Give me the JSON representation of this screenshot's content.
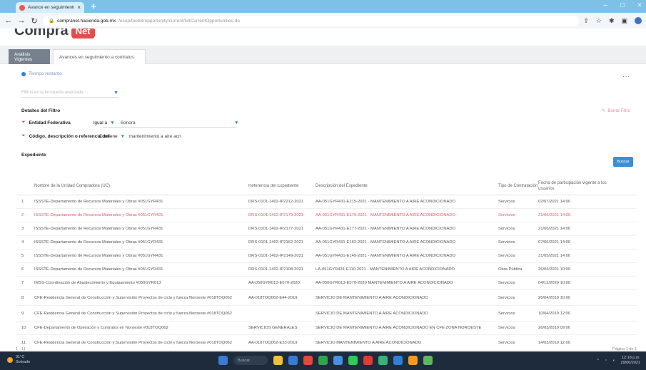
{
  "browser": {
    "tab_title": "Avance en seguimiento a con",
    "tab_close": "×",
    "new_tab": "+",
    "url_host": "compranet.hacienda.gob.mx",
    "url_path": "/esop/toolkit/opportunity/current/listCurrentOpportunities.do",
    "controls": {
      "minimize": "–",
      "maximize": "□",
      "close": "×"
    }
  },
  "site": {
    "brand": "Compra",
    "badge": "Net"
  },
  "tabs": [
    {
      "label": "Análisis Vigentes"
    },
    {
      "label": "Avances en seguimiento a contratos"
    }
  ],
  "info_link": "Tiempo restante",
  "more": "...",
  "filter_select_placeholder": "Filtros en la búsqueda avanzada",
  "details_title": "Detalles del Filtro",
  "clear_filters": "Borrar Filtro",
  "filters": [
    {
      "name": "Entidad Federativa",
      "operator": "Igual a",
      "value": "Sonora"
    },
    {
      "name": "Código, descripción o referencia del",
      "operator": "Contiene",
      "value": "mantenimiento a aire acn"
    }
  ],
  "expediente_label": "Expediente",
  "search_button": "Buscar",
  "table": {
    "headers": [
      "",
      "Nombre de la Unidad Compradora (UC)",
      "Referencia del Expediente",
      "Descripción del Expediente",
      "Tipo de Contratación",
      "Fecha de participación vigente a los usuarios"
    ],
    "rows": [
      {
        "n": "1",
        "uc": "ISSSTE-Departamento de Recursos Materiales y Obras #051GYR431",
        "ref": "DRS-0101-1402-IP2212-2021",
        "desc": "AA-051GYR431-E215-2021 - MANTENIMIENTO A AIRE ACONDICIONADO",
        "tipo": "Servicios",
        "fecha": "02/07/2021 14:00"
      },
      {
        "n": "2",
        "uc": "ISSSTE-Departamento de Recursos Materiales y Obras #051GYR431",
        "ref": "DRS-0101-1402-IP2179-2021",
        "desc": "AA-051GYR431-E179-2021 - MANTENIMIENTO A AIRE ACONDICIONADO",
        "tipo": "Servicios",
        "fecha": "21/06/2021 14:00"
      },
      {
        "n": "3",
        "uc": "ISSSTE-Departamento de Recursos Materiales y Obras #051GYR431",
        "ref": "DRS-0101-1402-IP2177-2021",
        "desc": "AA-051GYR431-E177-2021 - MANTENIMIENTO A AIRE ACONDICIONADO",
        "tipo": "Servicios",
        "fecha": "21/06/2021 14:00"
      },
      {
        "n": "4",
        "uc": "ISSSTE-Departamento de Recursos Materiales y Obras #051GYR431",
        "ref": "DRS-0101-1402-IP2162-2021",
        "desc": "AA-051GYR431-E162-2021 - MANTENIMIENTO A AIRE ACONDICIONADO",
        "tipo": "Servicios",
        "fecha": "07/06/2021 14:00"
      },
      {
        "n": "5",
        "uc": "ISSSTE-Departamento de Recursos Materiales y Obras #051GYR431",
        "ref": "DRS-0101-1402-IP2149-2021",
        "desc": "AA-051GYR431-E149-2021 - MANTENIMIENTO A AIRE ACONDICIONADO",
        "tipo": "Servicios",
        "fecha": "31/05/2021 14:00"
      },
      {
        "n": "6",
        "uc": "ISSSTE-Departamento de Recursos Materiales y Obras #051GYR431",
        "ref": "DRS-0101-1402-IP2108-2021",
        "desc": "LA-051GYR431-E110-2021 - MANTENIMIENTO A AIRE ACONDICIONADO",
        "tipo": "Obra Pública",
        "fecha": "26/04/2021 10:00"
      },
      {
        "n": "7",
        "uc": "IMSS-Coordinación de Abastecimiento y Equipamiento #050GYR013",
        "ref": "AA-050GYR013-E570-2020",
        "desc": "AA-050GYR013-E570-2020 MANTENIMIENTO A AIRE ACONDICIONADO",
        "tipo": "Servicios",
        "fecha": "04/12/2020 10:00"
      },
      {
        "n": "8",
        "uc": "CFE-Residencia General de Construcción y Supervisión Proyectos de ciclo y fuerza Noroeste #018TOQ062",
        "ref": "AA-018TOQ062-E44-2019",
        "desc": "SERVICIO DE MANTENIMIENTO A AIRE ACONDICIONADO",
        "tipo": "Servicios",
        "fecha": "26/04/2019 10:00"
      },
      {
        "n": "9",
        "uc": "CFE-Residencia General de Construcción y Supervisión Proyectos de ciclo y fuerza Noroeste #018TOQ062",
        "ref": "",
        "desc": "SERVICIO DE MANTENIMIENTO A AIRE ACONDICIONADO",
        "tipo": "Servicios",
        "fecha": "10/04/2019 12:00"
      },
      {
        "n": "10",
        "uc": "CFE-Departamento de Operación y Contratos en Noroeste #018TOQ062",
        "ref": "SERVICIOS GENERALES",
        "desc": "SERVICIO DE MANTENIMIENTO A AIRE ACONDICIONADO EN CFE ZONA NOROESTE",
        "tipo": "Servicios",
        "fecha": "26/03/2019 09:00"
      },
      {
        "n": "11",
        "uc": "CFE-Residencia General de Construcción y Supervisión Proyectos de ciclo y fuerza Noroeste #018TOQ062",
        "ref": "AA-018TOQ062-E33-2019",
        "desc": "SERVICIO MANTENIMIENTO A AIRE ACONDICIONADO",
        "tipo": "Servicios",
        "fecha": "14/03/2019 12:00"
      }
    ]
  },
  "footer": {
    "left": "1 - 11",
    "right": "Página 1 de 1"
  },
  "taskbar": {
    "weather_temp": "31°C",
    "weather_desc": "Soleado",
    "search": "Buscar",
    "clock_time": "12:18 p.m.",
    "clock_date": "29/06/2021",
    "icon_colors": [
      "#3a7bd5",
      "#f3c13a",
      "#3a7bd5",
      "#e24a3b",
      "#2ea44f",
      "#4a90e2",
      "#34c759",
      "#e03c31",
      "#3bb273",
      "#2f7fd8",
      "#f09a2a",
      "#5cb85c"
    ]
  }
}
